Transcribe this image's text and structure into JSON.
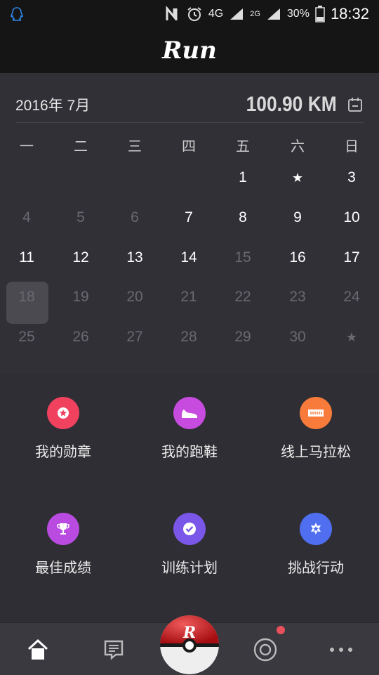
{
  "status_bar": {
    "network": "4G",
    "sim1": "4G",
    "sim2": "2G",
    "battery": "30%",
    "time": "18:32"
  },
  "app": {
    "logo": "Run"
  },
  "calendar": {
    "month_label": "2016年 7月",
    "distance": "100.90 KM",
    "weekdays": [
      "一",
      "二",
      "三",
      "四",
      "五",
      "六",
      "日"
    ],
    "weeks": [
      [
        null,
        null,
        null,
        null,
        {
          "t": "1",
          "s": "a"
        },
        {
          "t": "★",
          "s": "star"
        },
        {
          "t": "3",
          "s": "a"
        }
      ],
      [
        {
          "t": "4",
          "s": "d"
        },
        {
          "t": "5",
          "s": "d"
        },
        {
          "t": "6",
          "s": "d"
        },
        {
          "t": "7",
          "s": "a"
        },
        {
          "t": "8",
          "s": "a"
        },
        {
          "t": "9",
          "s": "a"
        },
        {
          "t": "10",
          "s": "a"
        }
      ],
      [
        {
          "t": "11",
          "s": "a"
        },
        {
          "t": "12",
          "s": "a"
        },
        {
          "t": "13",
          "s": "a"
        },
        {
          "t": "14",
          "s": "a"
        },
        {
          "t": "15",
          "s": "d"
        },
        {
          "t": "16",
          "s": "a"
        },
        {
          "t": "17",
          "s": "a"
        }
      ],
      [
        {
          "t": "18",
          "s": "d"
        },
        {
          "t": "19",
          "s": "d"
        },
        {
          "t": "20",
          "s": "d"
        },
        {
          "t": "21",
          "s": "d"
        },
        {
          "t": "22",
          "s": "d"
        },
        {
          "t": "23",
          "s": "d"
        },
        {
          "t": "24",
          "s": "d"
        }
      ],
      [
        {
          "t": "25",
          "s": "d"
        },
        {
          "t": "26",
          "s": "d"
        },
        {
          "t": "27",
          "s": "d"
        },
        {
          "t": "28",
          "s": "d"
        },
        {
          "t": "29",
          "s": "d"
        },
        {
          "t": "30",
          "s": "d"
        },
        {
          "t": "★",
          "s": "dstar"
        }
      ]
    ],
    "today": "18"
  },
  "features": [
    {
      "label": "我的勋章",
      "icon": "medal-icon",
      "color": "#f0415e"
    },
    {
      "label": "我的跑鞋",
      "icon": "shoe-icon",
      "color": "#c84bdf"
    },
    {
      "label": "线上马拉松",
      "icon": "ticket-icon",
      "color": "#f87b3c"
    },
    {
      "label": "最佳成绩",
      "icon": "trophy-icon",
      "color": "#b94be0"
    },
    {
      "label": "训练计划",
      "icon": "check-icon",
      "color": "#7a57e8"
    },
    {
      "label": "挑战行动",
      "icon": "star-badge-icon",
      "color": "#4f6ff0"
    }
  ],
  "tabs": [
    "home-icon",
    "feed-icon",
    "pokeball-icon",
    "target-icon",
    "more-icon"
  ],
  "colors": {
    "accent_red": "#e8505b",
    "bg": "#2f2e34"
  }
}
